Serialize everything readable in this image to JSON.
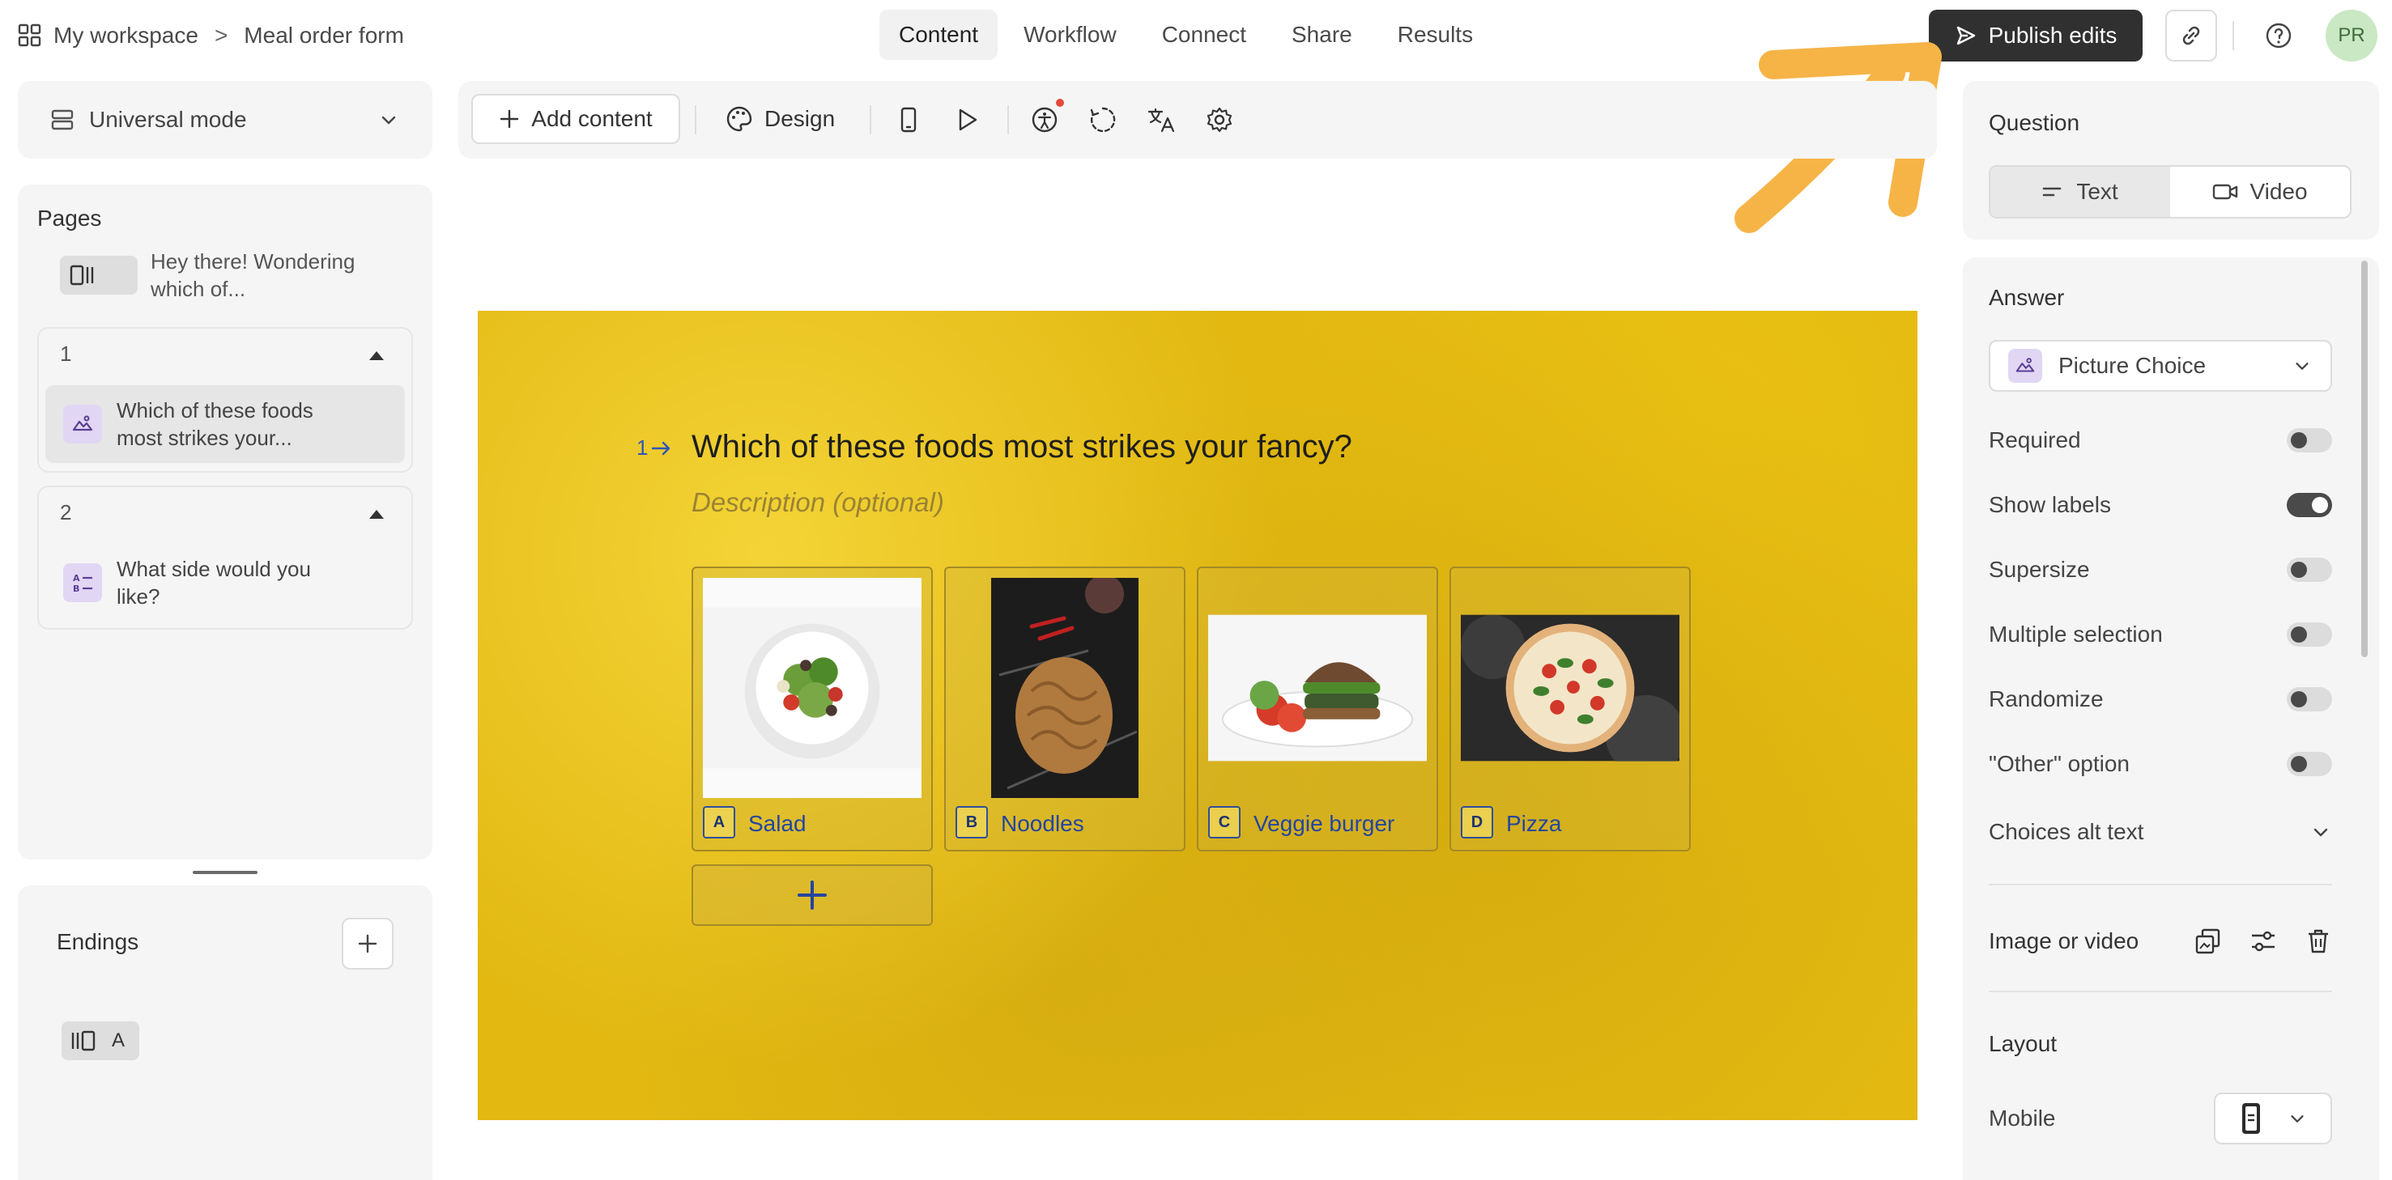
{
  "breadcrumb": {
    "workspace": "My workspace",
    "separator": ">",
    "form": "Meal order form"
  },
  "nav": {
    "tabs": [
      "Content",
      "Workflow",
      "Connect",
      "Share",
      "Results"
    ],
    "active": "Content"
  },
  "header": {
    "publish_label": "Publish edits",
    "avatar_initials": "PR"
  },
  "mode": {
    "label": "Universal mode"
  },
  "pages": {
    "title": "Pages",
    "welcome_text": "Hey there! Wondering which of...",
    "groups": [
      {
        "number": "1",
        "item_text": "Which of these foods most strikes your..."
      },
      {
        "number": "2",
        "item_text": "What side would you like?"
      }
    ]
  },
  "endings": {
    "title": "Endings",
    "ending_letter": "A"
  },
  "toolbar": {
    "add_content": "Add content",
    "design": "Design"
  },
  "question": {
    "number": "1",
    "title": "Which of these foods most strikes your fancy?",
    "description_placeholder": "Description (optional)",
    "choices": [
      {
        "letter": "A",
        "label": "Salad",
        "icon": "salad-image"
      },
      {
        "letter": "B",
        "label": "Noodles",
        "icon": "noodles-image"
      },
      {
        "letter": "C",
        "label": "Veggie burger",
        "icon": "burger-image"
      },
      {
        "letter": "D",
        "label": "Pizza",
        "icon": "pizza-image"
      }
    ]
  },
  "right_panel": {
    "question_title": "Question",
    "seg_text": "Text",
    "seg_video": "Video",
    "answer_title": "Answer",
    "answer_type": "Picture Choice",
    "options": [
      {
        "label": "Required",
        "on": false
      },
      {
        "label": "Show labels",
        "on": true
      },
      {
        "label": "Supersize",
        "on": false
      },
      {
        "label": "Multiple selection",
        "on": false
      },
      {
        "label": "Randomize",
        "on": false
      },
      {
        "label": "\"Other\" option",
        "on": false
      }
    ],
    "alt_text_label": "Choices alt text",
    "image_video_label": "Image or video",
    "layout_title": "Layout",
    "mobile_label": "Mobile"
  },
  "colors": {
    "accent_arrow": "#f6b447",
    "publish_bg": "#303030",
    "canvas_bg": "#e2b811",
    "choice_text": "#2346a0"
  }
}
